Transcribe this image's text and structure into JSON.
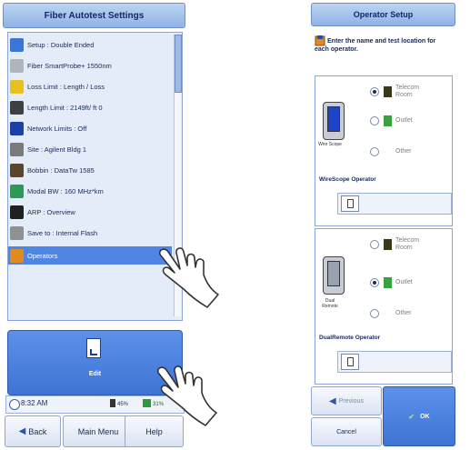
{
  "left": {
    "title": "Fiber Autotest Settings",
    "items": [
      {
        "label": "Setup : Double Ended",
        "icon": "setup-icon"
      },
      {
        "label": "Fiber SmartProbe+ 1550nm",
        "icon": "smartprobe-icon"
      },
      {
        "label": "Loss Limit : Length / Loss",
        "icon": "loss-limit-icon"
      },
      {
        "label": "Length Limit : 2149ft/ ft  0",
        "icon": "length-limit-icon"
      },
      {
        "label": "Network Limits : Off",
        "icon": "network-limits-icon"
      },
      {
        "label": "Site : Agilent Bldg 1",
        "icon": "site-icon"
      },
      {
        "label": "Bobbin : DataTw 1585",
        "icon": "bobbin-icon"
      },
      {
        "label": "Modal BW : 160  MHz*km",
        "icon": "modal-bw-icon"
      },
      {
        "label": "ARP : Overview",
        "icon": "arp-icon"
      },
      {
        "label": "Save to : Internal Flash",
        "icon": "save-icon"
      },
      {
        "label": "Operators",
        "icon": "operators-icon",
        "selected": true
      }
    ],
    "edit_label": "Edit",
    "status": {
      "time": "8:32 AM",
      "battery": "45%",
      "signal": "31%"
    },
    "buttons": {
      "back": "Back",
      "main_menu": "Main Menu",
      "help": "Help"
    }
  },
  "right": {
    "title": "Operator Setup",
    "instruction": "Enter the name and test location for each operator.",
    "wirescope": {
      "device_caption": "Wire Scope",
      "options": [
        {
          "label": "Telecom Room",
          "checked": true,
          "icon": "telecom-room-icon"
        },
        {
          "label": "Outlet",
          "checked": false,
          "icon": "outlet-icon"
        },
        {
          "label": "Other",
          "checked": false,
          "icon": ""
        }
      ],
      "field_label": "WireScope Operator"
    },
    "dualremote": {
      "device_caption": "Dual Remote",
      "options": [
        {
          "label": "Telecom Room",
          "checked": false,
          "icon": "telecom-room-icon"
        },
        {
          "label": "Outlet",
          "checked": true,
          "icon": "outlet-icon"
        },
        {
          "label": "Other",
          "checked": false,
          "icon": ""
        }
      ],
      "field_label": "DualRemote Operator"
    },
    "buttons": {
      "previous": "Previous",
      "cancel": "Cancel",
      "ok": "OK"
    }
  },
  "colors": {
    "accent": "#4f86e6",
    "title_bg": "#a8c4ee",
    "panel_bg": "#e4ecf9"
  }
}
